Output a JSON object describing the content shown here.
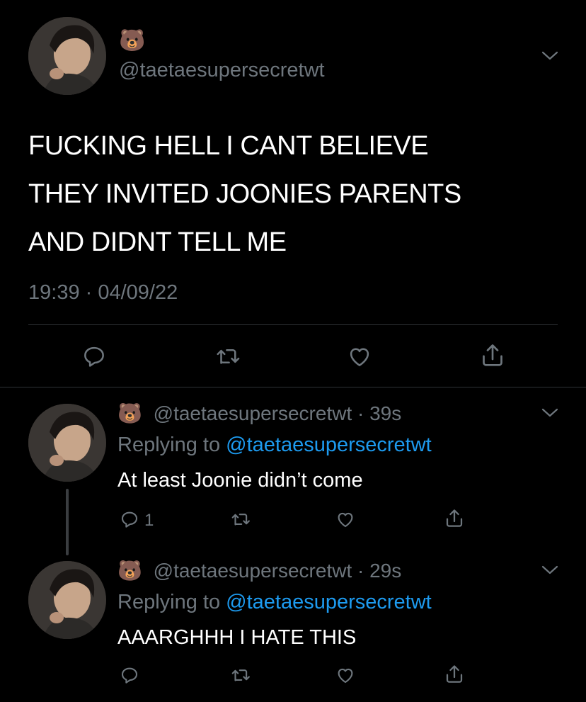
{
  "main_tweet": {
    "display_name": "🐻",
    "handle": "@taetaesupersecretwt",
    "text_lines": [
      "FUCKING HELL I CANT BELIEVE",
      "THEY INVITED JOONIES PARENTS",
      "AND DIDNT TELL ME"
    ],
    "timestamp": "19:39 · 04/09/22"
  },
  "replies": [
    {
      "display_name": "🐻",
      "handle": "@taetaesupersecretwt",
      "time": "· 39s",
      "replying_prefix": "Replying to ",
      "replying_handle": "@taetaesupersecretwt",
      "text": "At least Joonie didn’t come",
      "reply_count": "1"
    },
    {
      "display_name": "🐻",
      "handle": "@taetaesupersecretwt",
      "time": "· 29s",
      "replying_prefix": "Replying to ",
      "replying_handle": "@taetaesupersecretwt",
      "text": "AAARGHHH I HATE THIS",
      "reply_count": ""
    }
  ],
  "colors": {
    "background": "#000000",
    "text": "#ffffff",
    "secondary": "#6e767d",
    "link": "#1d9bf0",
    "divider": "#2f3336"
  },
  "icons": [
    "chevron-down-icon",
    "reply-icon",
    "retweet-icon",
    "like-icon",
    "share-icon"
  ]
}
